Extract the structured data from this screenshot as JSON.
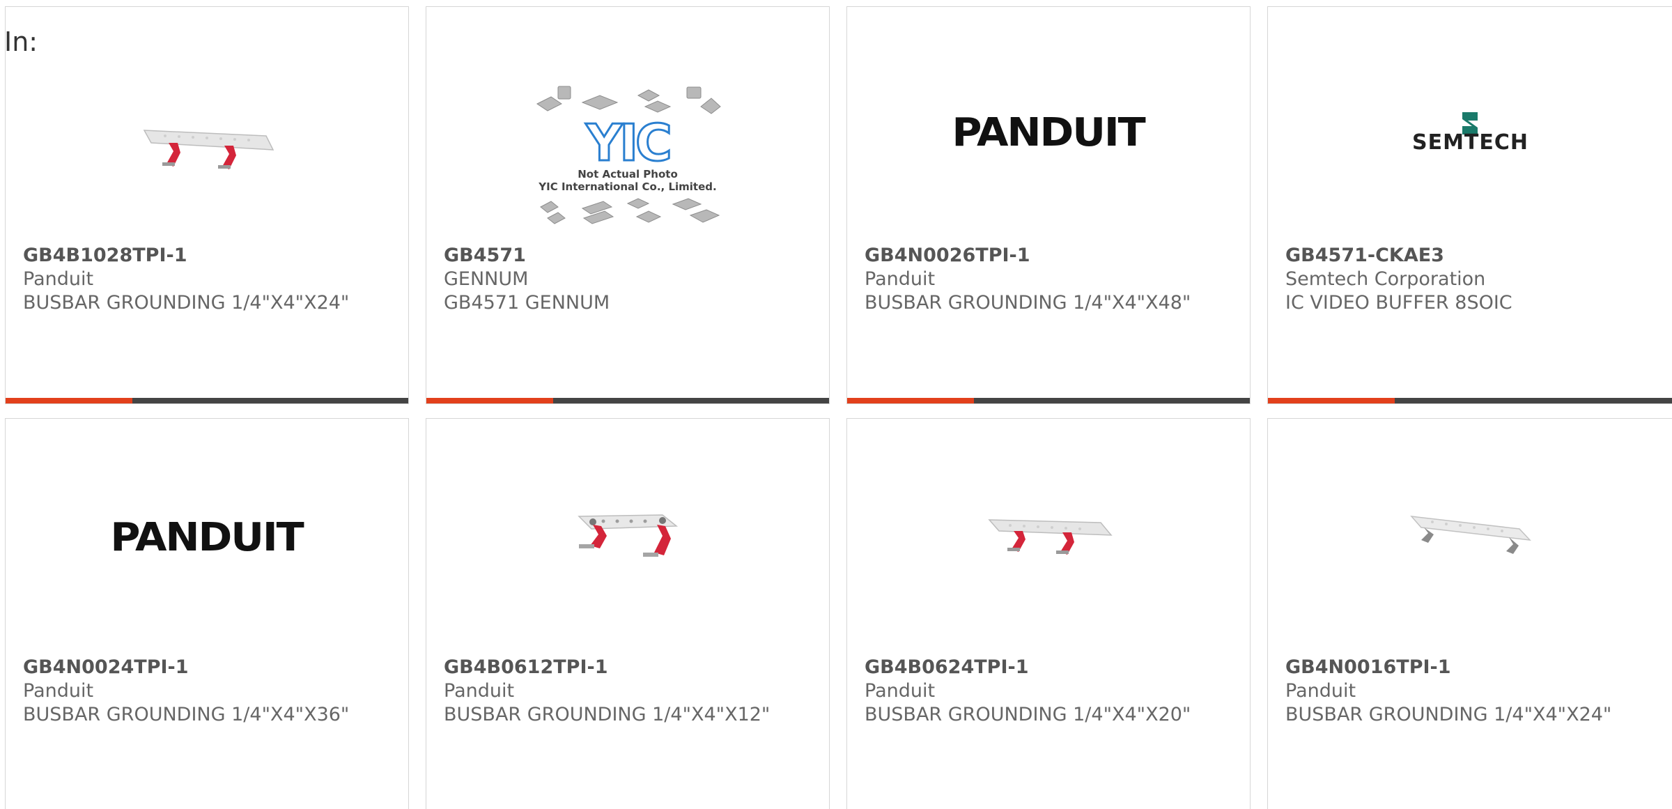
{
  "filter": {
    "label": "In:"
  },
  "colors": {
    "accent": "#e2401c",
    "bar": "#444444",
    "border": "#d6d6d6",
    "text": "#666666"
  },
  "products": [
    {
      "part": "GB4B1028TPI-1",
      "manufacturer": "Panduit",
      "description": "BUSBAR GROUNDING 1/4\"X4\"X24\"",
      "image": "busbar-long-image"
    },
    {
      "part": "GB4571",
      "manufacturer": "GENNUM",
      "description": "GB4571 GENNUM",
      "image": "yic-placeholder-image",
      "image_text": {
        "brand": "YIC",
        "line1": "Not Actual Photo",
        "line2": "YIC International Co., Limited."
      }
    },
    {
      "part": "GB4N0026TPI-1",
      "manufacturer": "Panduit",
      "description": "BUSBAR GROUNDING 1/4\"X4\"X48\"",
      "image": "panduit-logo",
      "image_text": {
        "brand": "PANDUIT"
      }
    },
    {
      "part": "GB4571-CKAE3",
      "manufacturer": "Semtech Corporation",
      "description": "IC VIDEO BUFFER 8SOIC",
      "image": "semtech-logo",
      "image_text": {
        "brand": "SEMTECH"
      }
    },
    {
      "part": "GB4N0024TPI-1",
      "manufacturer": "Panduit",
      "description": "BUSBAR GROUNDING 1/4\"X4\"X36\"",
      "image": "panduit-logo",
      "image_text": {
        "brand": "PANDUIT"
      }
    },
    {
      "part": "GB4B0612TPI-1",
      "manufacturer": "Panduit",
      "description": "BUSBAR GROUNDING 1/4\"X4\"X12\"",
      "image": "busbar-short-image"
    },
    {
      "part": "GB4B0624TPI-1",
      "manufacturer": "Panduit",
      "description": "BUSBAR GROUNDING 1/4\"X4\"X20\"",
      "image": "busbar-medium-image"
    },
    {
      "part": "GB4N0016TPI-1",
      "manufacturer": "Panduit",
      "description": "BUSBAR GROUNDING 1/4\"X4\"X24\"",
      "image": "busbar-long-grey-image"
    }
  ]
}
